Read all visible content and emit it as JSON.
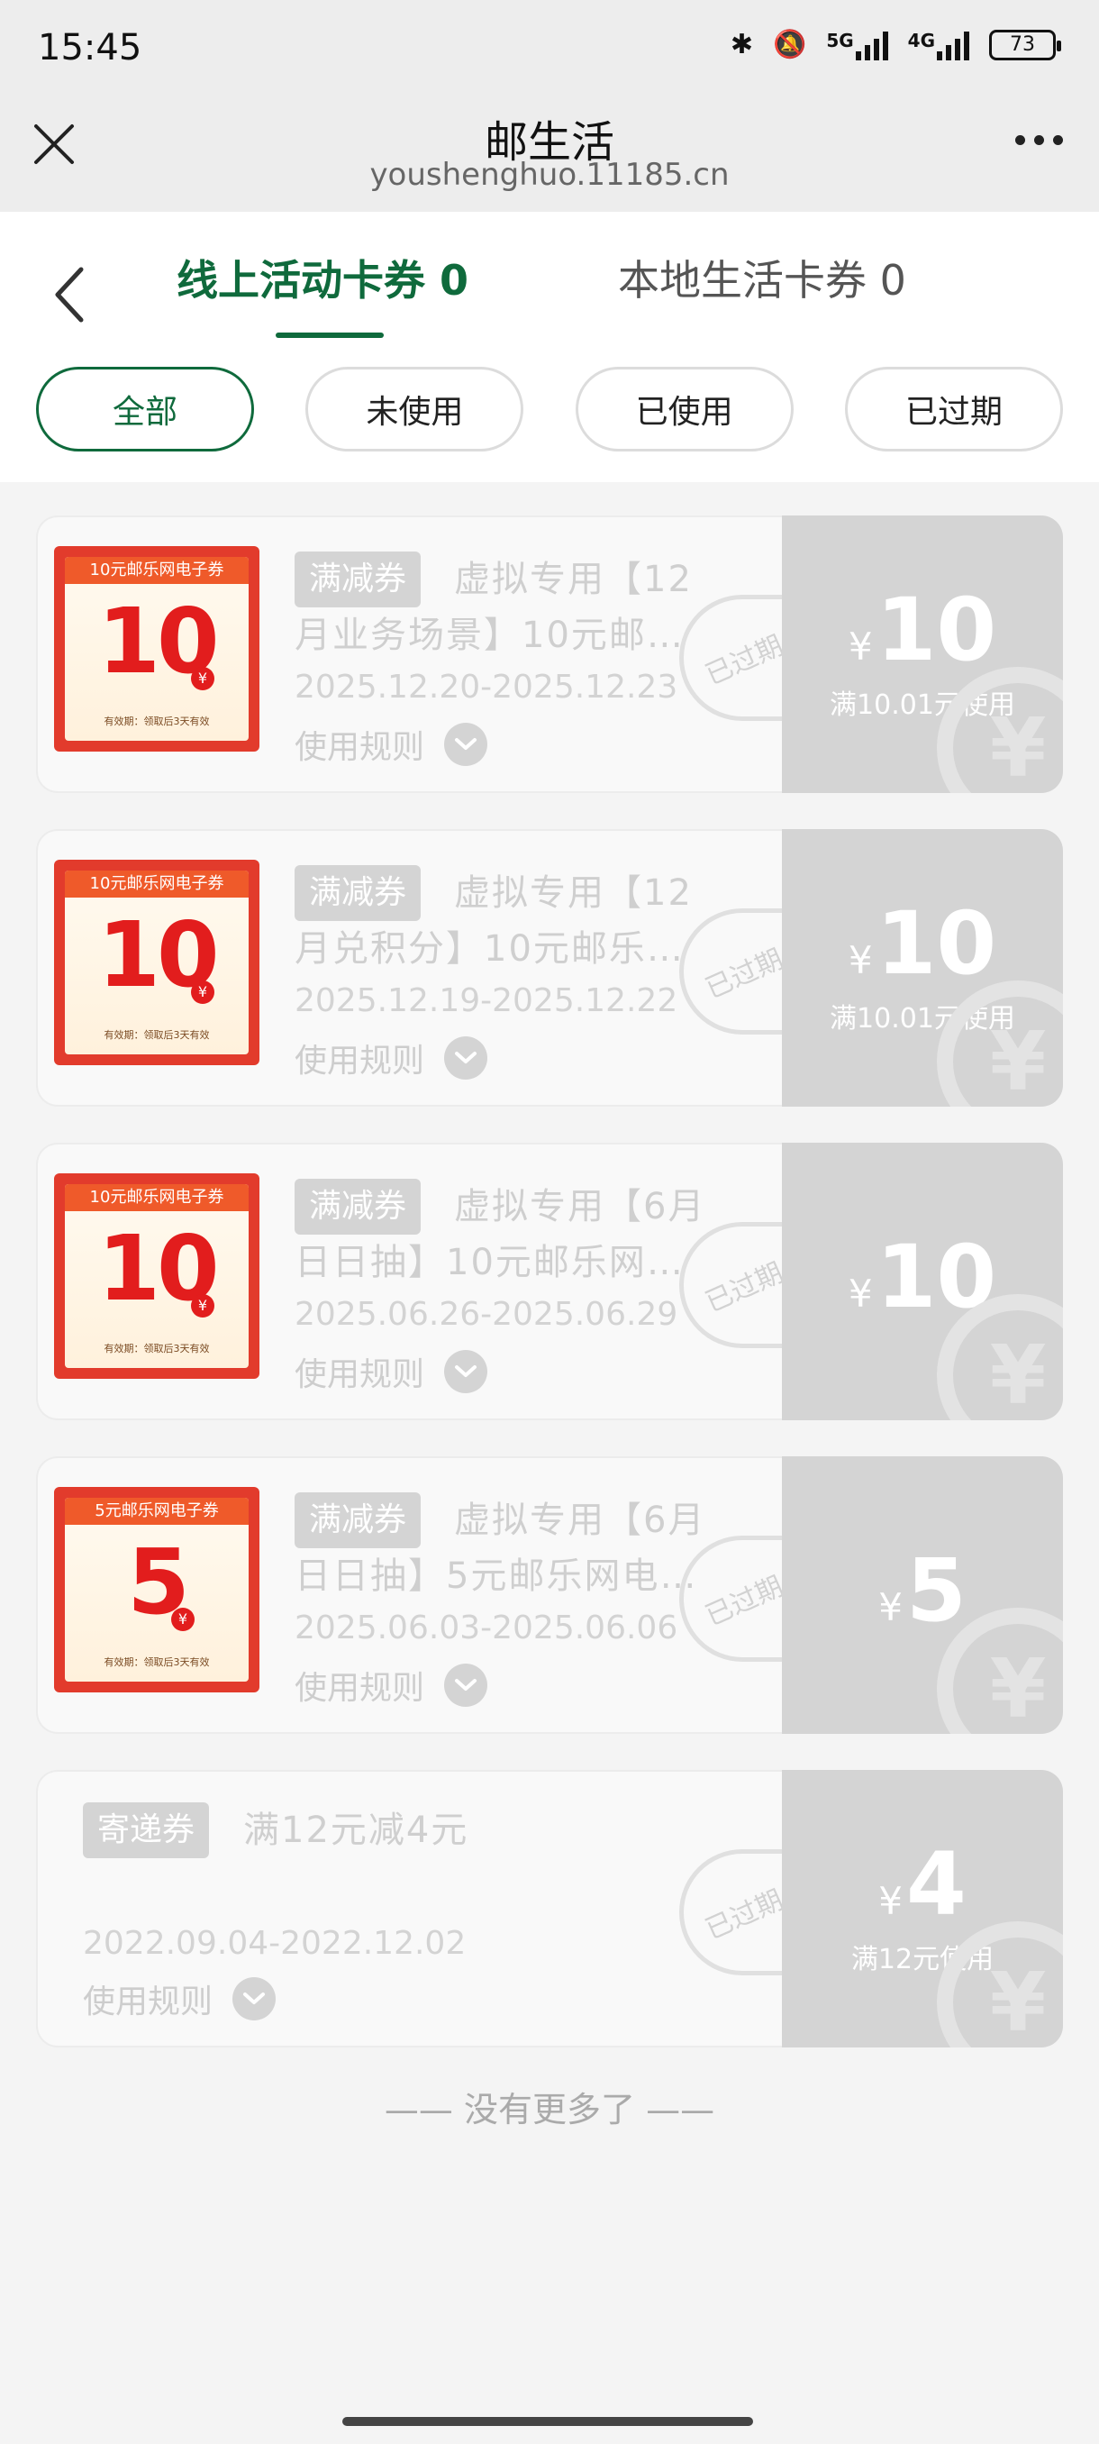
{
  "status": {
    "time": "15:45",
    "net1": "5G",
    "net2": "4G",
    "battery": "73"
  },
  "nav": {
    "title": "邮生活",
    "url": "youshenghuo.11185.cn"
  },
  "tabs": [
    {
      "label": "线上活动卡券 0",
      "active": true
    },
    {
      "label": "本地生活卡券 0",
      "active": false
    }
  ],
  "filters": [
    "全部",
    "未使用",
    "已使用",
    "已过期"
  ],
  "coupons": [
    {
      "tag": "满减券",
      "title_line1": "虚拟专用【12",
      "title_line2": "月业务场景】10元邮…",
      "date": "2025.12.20-2025.12.23",
      "rule": "使用规则",
      "stamp": "已过期",
      "yen": "¥",
      "amount": "10",
      "condition": "满10.01元使用",
      "thumb": {
        "head": "10元邮乐网电子券",
        "num": "10",
        "yen": "¥",
        "foot": "有效期：领取后3天有效"
      }
    },
    {
      "tag": "满减券",
      "title_line1": "虚拟专用【12",
      "title_line2": "月兑积分】10元邮乐…",
      "date": "2025.12.19-2025.12.22",
      "rule": "使用规则",
      "stamp": "已过期",
      "yen": "¥",
      "amount": "10",
      "condition": "满10.01元使用",
      "thumb": {
        "head": "10元邮乐网电子券",
        "num": "10",
        "yen": "¥",
        "foot": "有效期：领取后3天有效"
      }
    },
    {
      "tag": "满减券",
      "title_line1": "虚拟专用【6月",
      "title_line2": "日日抽】10元邮乐网…",
      "date": "2025.06.26-2025.06.29",
      "rule": "使用规则",
      "stamp": "已过期",
      "yen": "¥",
      "amount": "10",
      "condition": "",
      "thumb": {
        "head": "10元邮乐网电子券",
        "num": "10",
        "yen": "¥",
        "foot": "有效期：领取后3天有效"
      }
    },
    {
      "tag": "满减券",
      "title_line1": "虚拟专用【6月",
      "title_line2": "日日抽】5元邮乐网电…",
      "date": "2025.06.03-2025.06.06",
      "rule": "使用规则",
      "stamp": "已过期",
      "yen": "¥",
      "amount": "5",
      "condition": "",
      "thumb": {
        "head": "5元邮乐网电子券",
        "num": "5",
        "yen": "¥",
        "foot": "有效期：领取后3天有效"
      }
    },
    {
      "tag": "寄递券",
      "title_line1": "满12元减4元",
      "date": "2022.09.04-2022.12.02",
      "rule": "使用规则",
      "stamp": "已过期",
      "yen": "¥",
      "amount": "4",
      "condition": "满12元使用"
    }
  ],
  "end_text": "—— 没有更多了 ——"
}
